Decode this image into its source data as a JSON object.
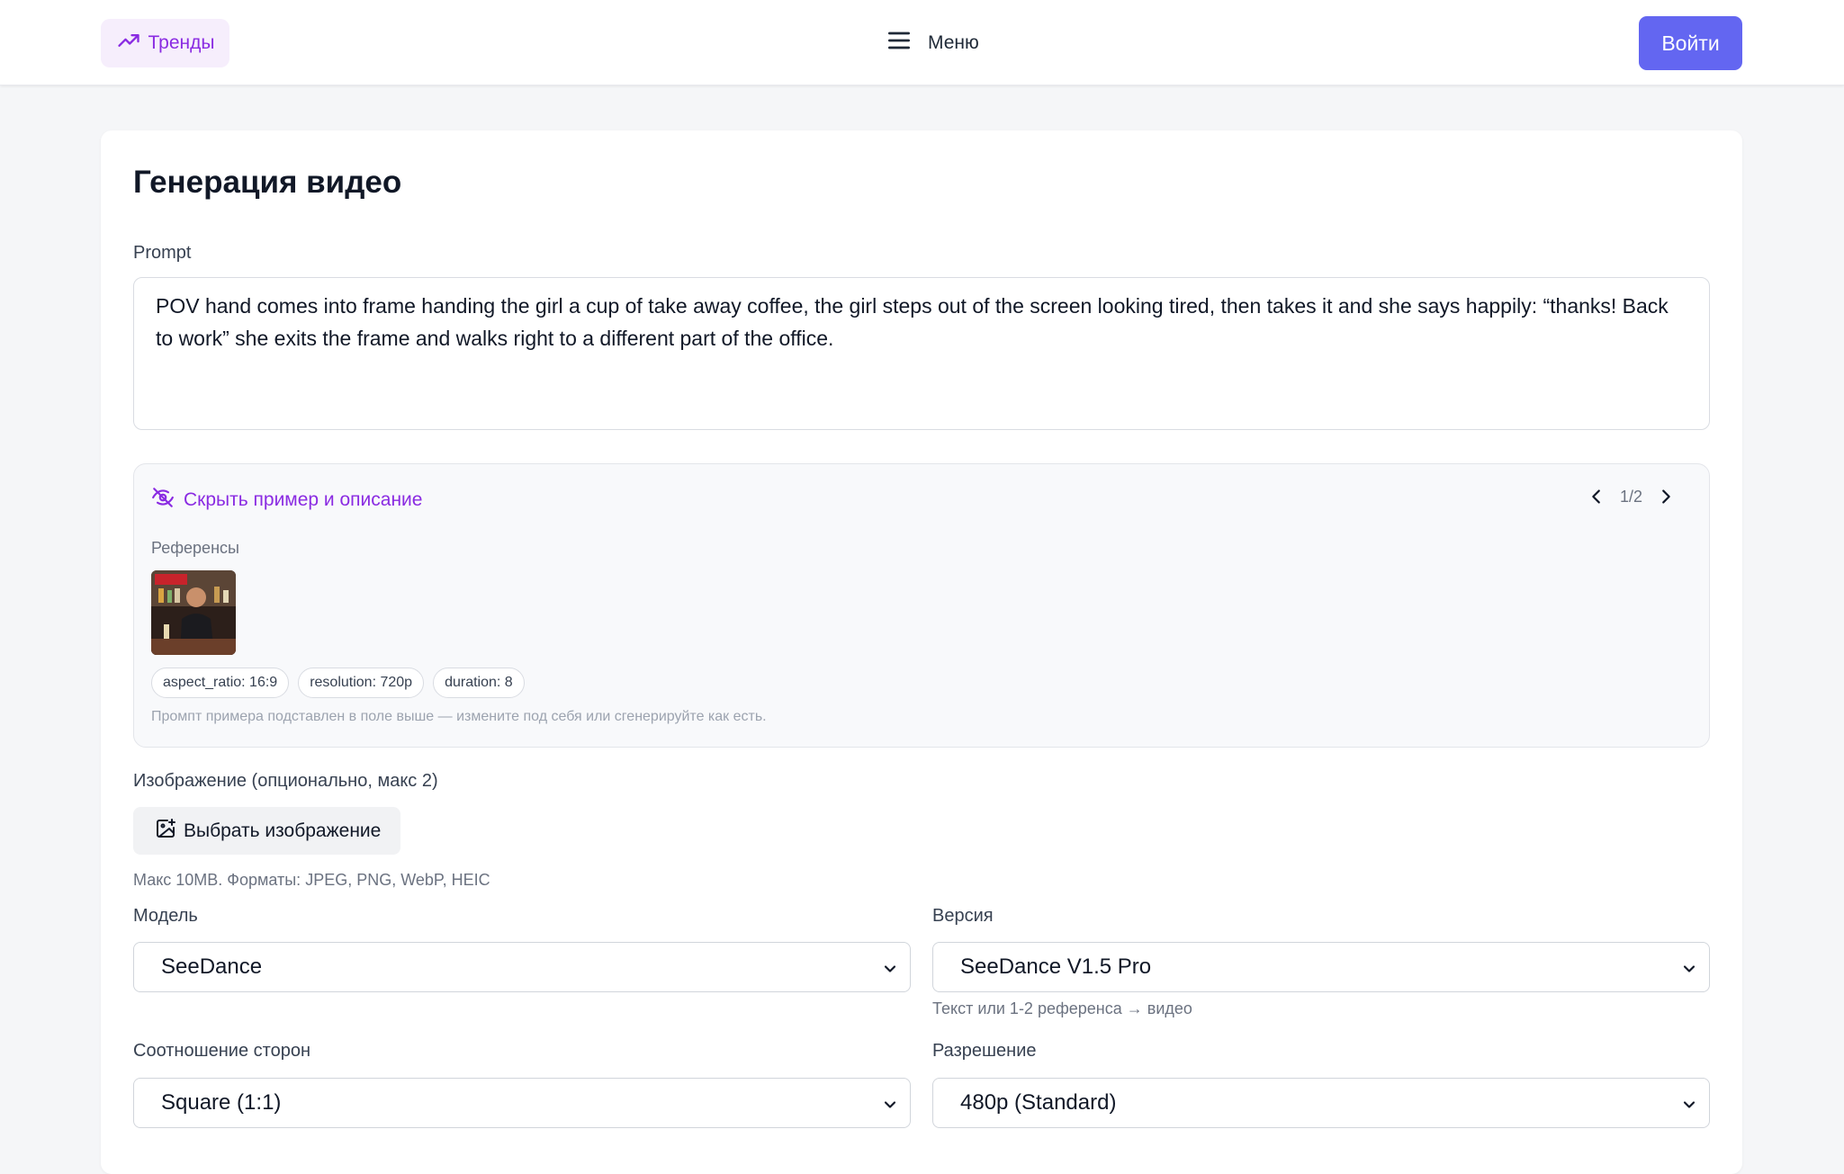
{
  "header": {
    "trends_label": "Тренды",
    "menu_label": "Меню",
    "login_label": "Войти"
  },
  "page": {
    "title": "Генерация видео"
  },
  "prompt": {
    "label": "Prompt",
    "value": "POV hand comes into frame handing the girl a cup of take away coffee, the girl steps out of the screen looking tired, then takes it and she says happily: “thanks! Back to work” she exits the frame and walks right to a different part of the office."
  },
  "example": {
    "toggle_label": "Скрыть пример и описание",
    "pager": "1/2",
    "references_label": "Референсы",
    "chips": [
      "aspect_ratio: 16:9",
      "resolution: 720p",
      "duration: 8"
    ],
    "note": "Промпт примера подставлен в поле выше — измените под себя или сгенерируйте как есть."
  },
  "image_upload": {
    "label": "Изображение (опционально, макс 2)",
    "button_label": "Выбрать изображение",
    "hint": "Макс 10MB. Форматы: JPEG, PNG, WebP, HEIC"
  },
  "model": {
    "label": "Модель",
    "value": "SeeDance"
  },
  "version": {
    "label": "Версия",
    "value": "SeeDance V1.5 Pro",
    "hint": "Текст или 1-2 референса → видео"
  },
  "aspect": {
    "label": "Соотношение сторон",
    "value": "Square (1:1)"
  },
  "resolution": {
    "label": "Разрешение",
    "value": "480p (Standard)"
  },
  "colors": {
    "accent": "#6366f1",
    "purple": "#8a2be2",
    "trends_bg": "#f6eefc"
  }
}
